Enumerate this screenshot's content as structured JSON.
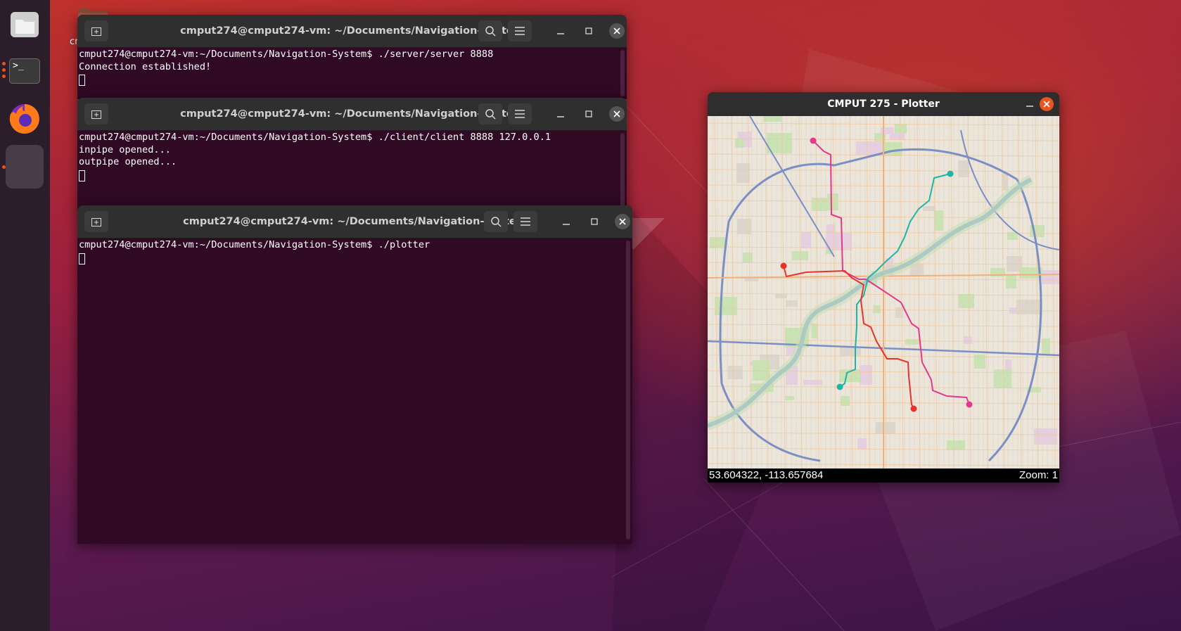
{
  "desktop": {
    "folder_label": "cm"
  },
  "dock": {
    "items": [
      {
        "name": "files-icon"
      },
      {
        "name": "terminal-icon",
        "glyph": ">_"
      },
      {
        "name": "firefox-icon"
      },
      {
        "name": "plotter-app-icon"
      }
    ]
  },
  "terminals": [
    {
      "title": "cmput274@cmput274-vm: ~/Documents/Navigation-System",
      "lines": [
        "cmput274@cmput274-vm:~/Documents/Navigation-System$ ./server/server 8888",
        "Connection established!"
      ]
    },
    {
      "title": "cmput274@cmput274-vm: ~/Documents/Navigation-System",
      "lines": [
        "cmput274@cmput274-vm:~/Documents/Navigation-System$ ./client/client 8888 127.0.0.1",
        "inpipe opened...",
        "outpipe opened..."
      ]
    },
    {
      "title": "cmput274@cmput274-vm: ~/Documents/Navigation-System",
      "lines": [
        "cmput274@cmput274-vm:~/Documents/Navigation-System$ ./plotter"
      ]
    }
  ],
  "plotter": {
    "title": "CMPUT 275 - Plotter",
    "coordinates": "53.604322, -113.657684",
    "zoom": "Zoom: 1",
    "route_colors": {
      "magenta": "#e0398f",
      "teal": "#1fb5a6",
      "red": "#e8332a"
    }
  }
}
